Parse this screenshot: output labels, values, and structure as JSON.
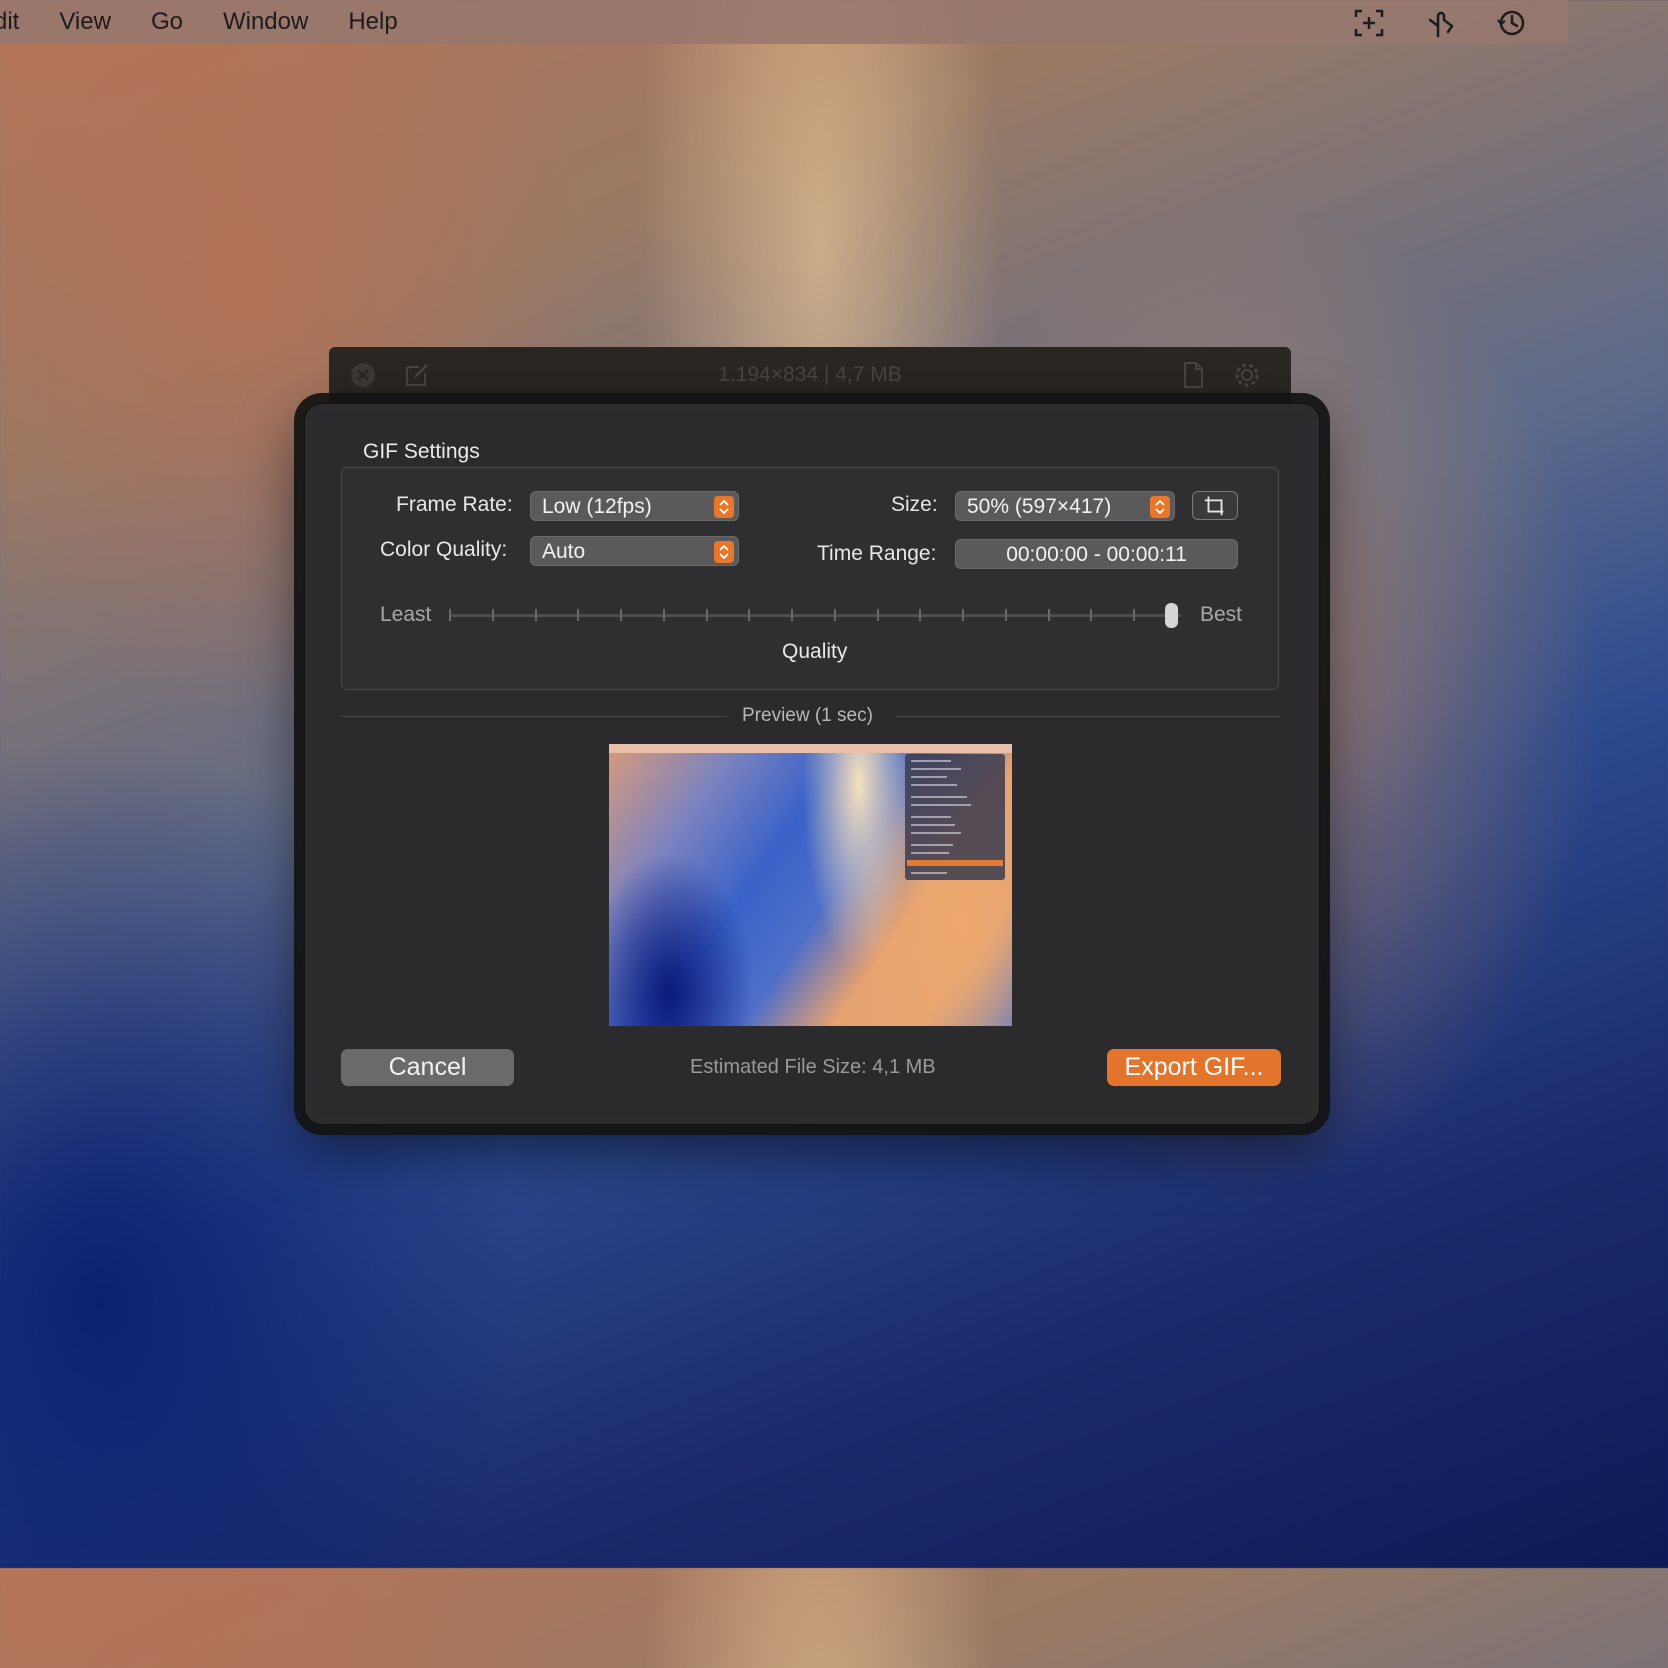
{
  "menubar": {
    "items": [
      "dit",
      "View",
      "Go",
      "Window",
      "Help"
    ],
    "right_icons": [
      "capture-area-icon",
      "hand-pointer-icon",
      "history-icon"
    ]
  },
  "background_window": {
    "title": "1.194×834 | 4,7 MB",
    "icons": [
      "close-icon",
      "edit-icon",
      "document-icon",
      "gear-icon"
    ]
  },
  "dialog": {
    "group_title": "GIF Settings",
    "frame_rate": {
      "label": "Frame Rate:",
      "value": "Low (12fps)"
    },
    "color_quality": {
      "label": "Color Quality:",
      "value": "Auto"
    },
    "size": {
      "label": "Size:",
      "value": "50% (597×417)"
    },
    "time_range": {
      "label": "Time Range:",
      "value": "00:00:00 - 00:00:11"
    },
    "quality_slider": {
      "min_label": "Least",
      "max_label": "Best",
      "caption": "Quality",
      "value": 1.0,
      "ticks": 17
    },
    "preview_label": "Preview (1 sec)",
    "estimated_size": "Estimated File Size: 4,1 MB",
    "cancel_label": "Cancel",
    "export_label": "Export GIF..."
  },
  "colors": {
    "accent": "#e2742b",
    "dialog_bg": "#2b2b2d"
  }
}
